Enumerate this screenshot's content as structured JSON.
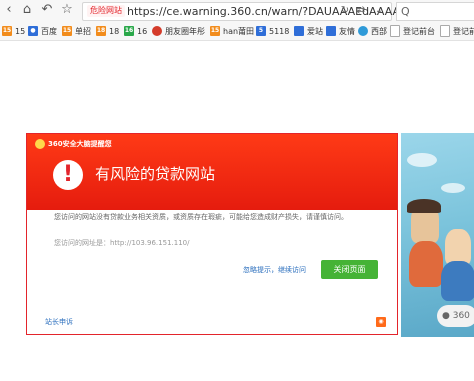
{
  "address_bar": {
    "warning_badge": "危险网站",
    "url": "https://ce.warning.360.cn/warn/?DAUAAAEdAAAA",
    "icons": [
      "reload-icon",
      "share-icon",
      "menu-chevron-icon"
    ]
  },
  "search": {
    "value": "Q"
  },
  "bookmarks": [
    {
      "label": "15",
      "icon": "15-icon",
      "color": "#f28c1c"
    },
    {
      "label": "百度",
      "icon": "baidu-icon",
      "color": "#2f6ed8"
    },
    {
      "label": "单招",
      "icon": "15-icon",
      "color": "#f28c1c"
    },
    {
      "label": "18",
      "icon": "18-icon",
      "color": "#f28c1c"
    },
    {
      "label": "16",
      "icon": "16-icon",
      "color": "#2aa84a"
    },
    {
      "label": "朋友圈年彤",
      "icon": "pengyou-icon",
      "color": "#d43b2a"
    },
    {
      "label": "han莆田",
      "icon": "15-icon",
      "color": "#f28c1c"
    },
    {
      "label": "5118",
      "icon": "5118-icon",
      "color": "#2f6ed8"
    },
    {
      "label": "爱站",
      "icon": "aizhan-icon",
      "color": "#2f6ed8"
    },
    {
      "label": "友情",
      "icon": "youqing-icon",
      "color": "#2f6ed8"
    },
    {
      "label": "西部",
      "icon": "xibu-icon",
      "color": "#2f9ad8"
    },
    {
      "label": "登记前台",
      "icon": "page-icon",
      "color": "#aaaaaa"
    },
    {
      "label": "登记前",
      "icon": "page-icon",
      "color": "#aaaaaa"
    }
  ],
  "dialog": {
    "brand": "360安全大脑提醒您",
    "title": "有风险的贷款网站",
    "description": "您访问的网站没有贷款业务相关资质，或资质存在瑕疵，可能给您造成财产损失，请谨慎访问。",
    "site_address": "您访问的网址是：http://103.96.151.110/",
    "ignore_link": "忽略提示，继续访问",
    "close_button": "关闭页面",
    "report_link": "站长申诉"
  },
  "illustration": {
    "pill_label": "360"
  },
  "colors": {
    "danger": "#e3242b",
    "banner": "#ff3a16",
    "button": "#45b336",
    "link": "#2a6ebd"
  }
}
